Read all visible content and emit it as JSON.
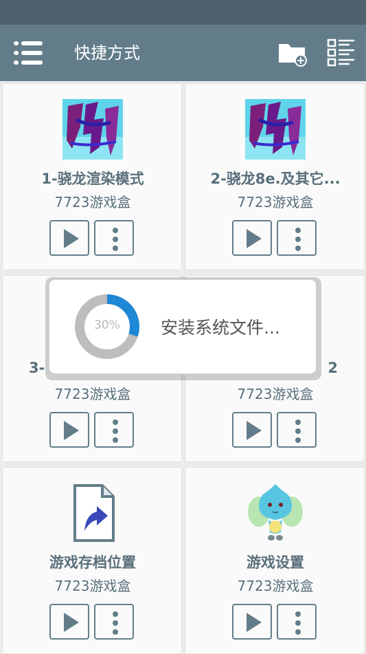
{
  "app_bar": {
    "title": "快捷方式",
    "menu_icon": "list-menu-icon",
    "add_folder_icon": "folder-add-icon",
    "view_toggle_icon": "checklist-view-icon"
  },
  "cards": [
    {
      "name": "1-骁龙渲染模式",
      "subtitle": "7723游戏盒",
      "icon": "xianjian-game-icon"
    },
    {
      "name": "2-骁龙8e.及其它...",
      "subtitle": "7723游戏盒",
      "icon": "xianjian-game-icon"
    },
    {
      "name": "3-",
      "subtitle": "7723游戏盒",
      "icon": "hidden"
    },
    {
      "name": "2",
      "subtitle": "7723游戏盒",
      "icon": "hidden"
    },
    {
      "name": "游戏存档位置",
      "subtitle": "7723游戏盒",
      "icon": "shortcut-file-icon"
    },
    {
      "name": "游戏设置",
      "subtitle": "7723游戏盒",
      "icon": "fairy-character-icon"
    }
  ],
  "progress_dialog": {
    "percent_label": "30%",
    "progress": 0.3,
    "message": "安装系统文件..."
  },
  "colors": {
    "status_bar": "#4e616c",
    "app_bar": "#627d89",
    "accent": "#1e88d6",
    "track": "#bdbdbd"
  }
}
